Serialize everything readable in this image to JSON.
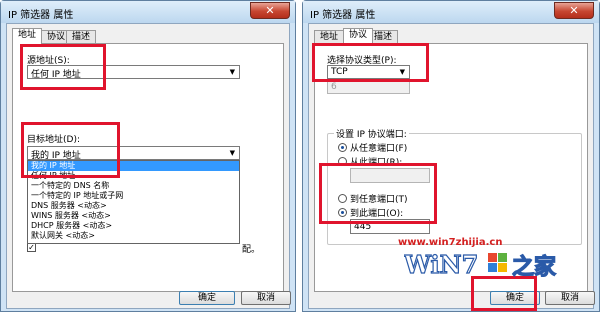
{
  "left_dialog": {
    "title": "IP 筛选器 属性",
    "close": "✕",
    "tabs": [
      {
        "label": "地址"
      },
      {
        "label": "协议"
      },
      {
        "label": "描述"
      }
    ],
    "source_label": "源地址(S):",
    "source_value": "任何 IP 地址",
    "dest_label": "目标地址(D):",
    "dest_value": "我的 IP 地址",
    "dropdown_options": [
      "我的 IP 地址",
      "任何 IP 地址",
      "一个特定的 DNS 名称",
      "一个特定的 IP 地址或子网",
      "DNS 服务器 <动态>",
      "WINS 服务器 <动态>",
      "DHCP 服务器 <动态>",
      "默认网关 <动态>"
    ],
    "checkbox_tail": "配。",
    "ok": "确定",
    "cancel": "取消"
  },
  "right_dialog": {
    "title": "IP 筛选器 属性",
    "close": "✕",
    "tabs": [
      {
        "label": "地址"
      },
      {
        "label": "协议"
      },
      {
        "label": "描述"
      }
    ],
    "protocol_label": "选择协议类型(P):",
    "protocol_value": "TCP",
    "protocol_number": "6",
    "port_group_title": "设置 IP 协议端口:",
    "from_any_port": "从任意端口(F)",
    "from_this_port": "从此端口(R):",
    "to_any_port": "到任意端口(T)",
    "to_this_port": "到此端口(O):",
    "port_value": "445",
    "ok": "确定",
    "cancel": "取消"
  },
  "watermark": {
    "url": "www.win7zhijia.cn",
    "logo_text": "Win7之家"
  },
  "colors": {
    "highlight": "#e0142d",
    "selection": "#3399ff",
    "title_bar": "#c6dcf1"
  }
}
